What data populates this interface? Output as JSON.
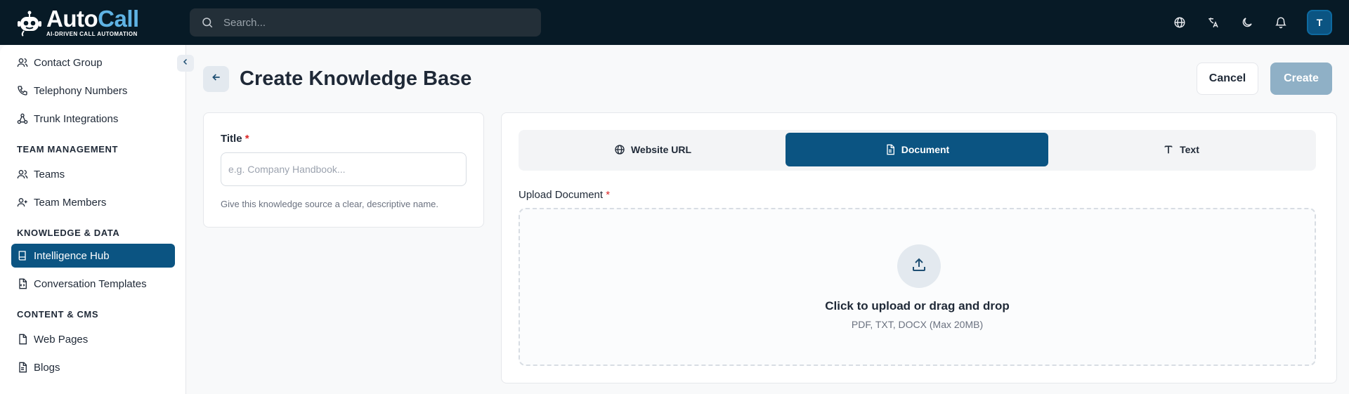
{
  "brand": {
    "name_part1": "Auto",
    "name_part2": "Call",
    "tagline": "AI-DRIVEN CALL AUTOMATION",
    "accent": "#5fb3e4"
  },
  "search": {
    "placeholder": "Search..."
  },
  "topbar": {
    "icons": [
      "globe-icon",
      "translate-icon",
      "moon-icon",
      "bell-icon"
    ],
    "avatar_initial": "T"
  },
  "sidebar": {
    "items": [
      {
        "label": "Contact Group",
        "icon": "users-icon"
      },
      {
        "label": "Telephony Numbers",
        "icon": "phone-icon"
      },
      {
        "label": "Trunk Integrations",
        "icon": "network-icon"
      },
      {
        "label": "Teams",
        "icon": "users-icon"
      },
      {
        "label": "Team Members",
        "icon": "user-plus-icon"
      },
      {
        "label": "Intelligence Hub",
        "icon": "book-icon",
        "active": true
      },
      {
        "label": "Conversation Templates",
        "icon": "file-code-icon"
      },
      {
        "label": "Web Pages",
        "icon": "file-icon"
      },
      {
        "label": "Blogs",
        "icon": "file-text-icon"
      }
    ],
    "sections": {
      "team_management": "TEAM MANAGEMENT",
      "knowledge_data": "KNOWLEDGE & DATA",
      "content_cms": "CONTENT & CMS"
    }
  },
  "page": {
    "title": "Create Knowledge Base",
    "cancel_label": "Cancel",
    "create_label": "Create"
  },
  "form": {
    "title_label": "Title",
    "required_mark": "*",
    "title_placeholder": "e.g. Company Handbook...",
    "title_value": "",
    "title_hint": "Give this knowledge source a clear, descriptive name."
  },
  "source": {
    "tabs": [
      {
        "label": "Website URL",
        "icon": "globe-icon"
      },
      {
        "label": "Document",
        "icon": "document-icon",
        "active": true
      },
      {
        "label": "Text",
        "icon": "text-icon"
      }
    ],
    "upload_label": "Upload Document",
    "upload_title": "Click to upload or drag and drop",
    "upload_subtitle": "PDF, TXT, DOCX (Max 20MB)"
  },
  "colors": {
    "primary": "#0b5482",
    "topbar": "#071a26",
    "create_disabled": "#8fb0c6",
    "required": "#dc2626"
  }
}
